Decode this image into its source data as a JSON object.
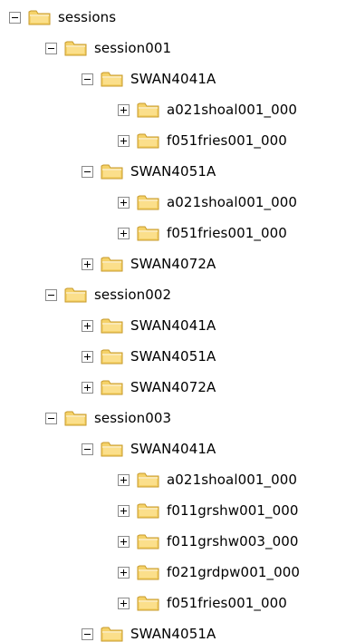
{
  "tree": [
    {
      "label": "sessions",
      "depth": 0,
      "expanded": true
    },
    {
      "label": "session001",
      "depth": 1,
      "expanded": true
    },
    {
      "label": "SWAN4041A",
      "depth": 2,
      "expanded": true
    },
    {
      "label": "a021shoal001_000",
      "depth": 3,
      "expanded": false
    },
    {
      "label": "f051fries001_000",
      "depth": 3,
      "expanded": false
    },
    {
      "label": "SWAN4051A",
      "depth": 2,
      "expanded": true
    },
    {
      "label": "a021shoal001_000",
      "depth": 3,
      "expanded": false
    },
    {
      "label": "f051fries001_000",
      "depth": 3,
      "expanded": false
    },
    {
      "label": "SWAN4072A",
      "depth": 2,
      "expanded": false
    },
    {
      "label": "session002",
      "depth": 1,
      "expanded": true
    },
    {
      "label": "SWAN4041A",
      "depth": 2,
      "expanded": false
    },
    {
      "label": "SWAN4051A",
      "depth": 2,
      "expanded": false
    },
    {
      "label": "SWAN4072A",
      "depth": 2,
      "expanded": false
    },
    {
      "label": "session003",
      "depth": 1,
      "expanded": true
    },
    {
      "label": "SWAN4041A",
      "depth": 2,
      "expanded": true
    },
    {
      "label": "a021shoal001_000",
      "depth": 3,
      "expanded": false
    },
    {
      "label": "f011grshw001_000",
      "depth": 3,
      "expanded": false
    },
    {
      "label": "f011grshw003_000",
      "depth": 3,
      "expanded": false
    },
    {
      "label": "f021grdpw001_000",
      "depth": 3,
      "expanded": false
    },
    {
      "label": "f051fries001_000",
      "depth": 3,
      "expanded": false
    },
    {
      "label": "SWAN4051A",
      "depth": 2,
      "expanded": true
    }
  ],
  "colors": {
    "background": "#ffffff",
    "expander_border": "#8b8b8b",
    "folder_fill": "#f5d269",
    "folder_outline": "#c79a2a"
  }
}
